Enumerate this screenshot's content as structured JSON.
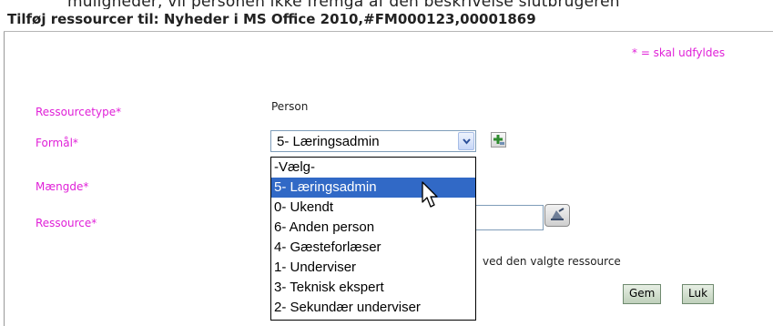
{
  "background_caption": "muligheder, vil personen ikke fremgå af den beskrivelse slutbrugeren",
  "dialog": {
    "title": "Tilføj ressourcer til: Nyheder i MS Office 2010,#FM000123,00001869",
    "required_note": "* = skal udfyldes"
  },
  "form": {
    "ressourcetype_label": "Ressourcetype*",
    "ressourcetype_value": "Person",
    "formaal_label": "Formål*",
    "formaal_selected": "5- Læringsadmin",
    "maengde_label": "Mængde*",
    "ressource_label": "Ressource*",
    "hint": "ved den valgte ressource"
  },
  "dropdown": {
    "options": [
      "-Vælg-",
      "5- Læringsadmin",
      "0- Ukendt",
      "6- Anden person",
      "4- Gæsteforlæser",
      "1- Underviser",
      "3- Teknisk ekspert",
      "2- Sekundær underviser"
    ],
    "highlighted_index": 1
  },
  "buttons": {
    "save": "Gem",
    "close": "Luk"
  },
  "colors": {
    "label_magenta": "#e020d8",
    "highlight_blue": "#3169c6"
  },
  "icons": {
    "add": "add-plus-icon",
    "picker": "resource-picker-icon",
    "dropdown": "chevron-down-icon",
    "cursor": "mouse-pointer-icon"
  }
}
